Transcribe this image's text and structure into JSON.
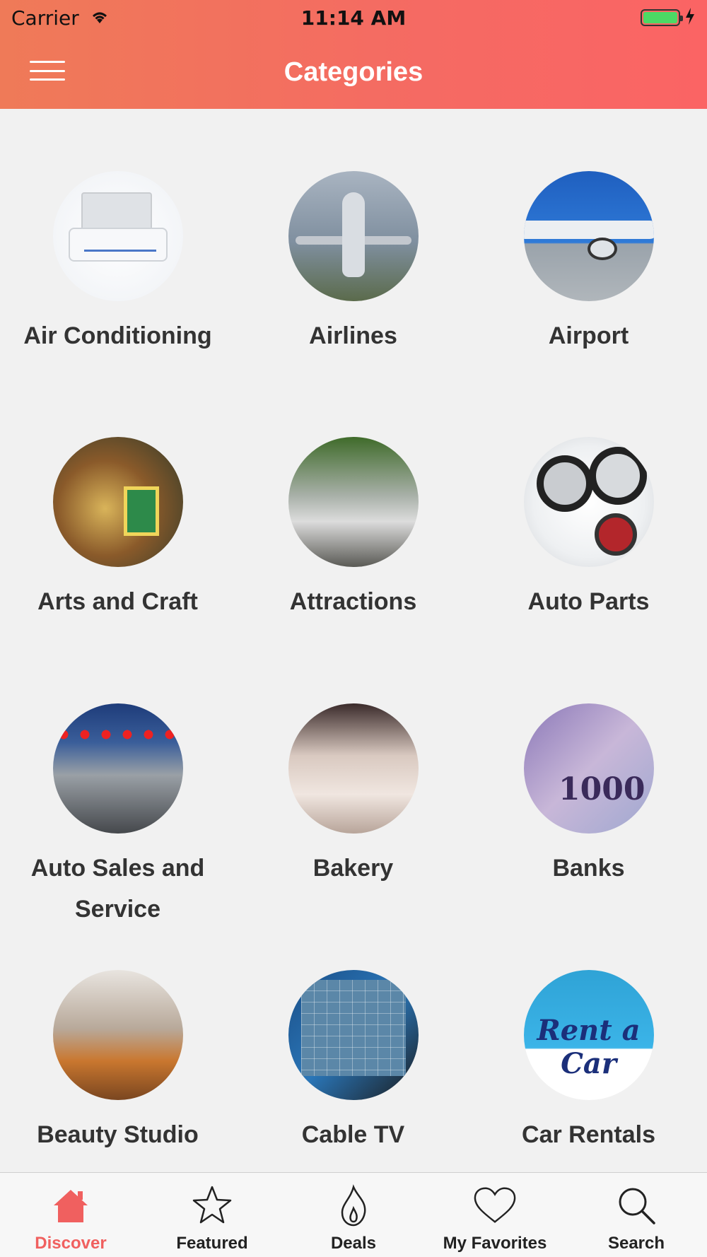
{
  "status_bar": {
    "carrier": "Carrier",
    "time": "11:14 AM"
  },
  "nav": {
    "title": "Categories",
    "menu_icon": "hamburger-menu-icon"
  },
  "colors": {
    "header_gradient_start": "#ef7a58",
    "header_gradient_end": "#fb6464",
    "active_tab": "#f0605f",
    "label_text": "#333333"
  },
  "categories": [
    {
      "label": "Air Conditioning",
      "icon": "air-conditioning-image"
    },
    {
      "label": "Airlines",
      "icon": "airlines-image"
    },
    {
      "label": "Airport",
      "icon": "airport-image"
    },
    {
      "label": "Arts and Craft",
      "icon": "arts-and-craft-image"
    },
    {
      "label": "Attractions",
      "icon": "attractions-image"
    },
    {
      "label": "Auto Parts",
      "icon": "auto-parts-image"
    },
    {
      "label": "Auto Sales and Service",
      "icon": "auto-sales-image"
    },
    {
      "label": "Bakery",
      "icon": "bakery-image"
    },
    {
      "label": "Banks",
      "icon": "banks-image"
    },
    {
      "label": "Beauty Studio",
      "icon": "beauty-studio-image"
    },
    {
      "label": "Cable TV",
      "icon": "cable-tv-image"
    },
    {
      "label": "Car Rentals",
      "icon": "car-rentals-image"
    }
  ],
  "tabs": [
    {
      "label": "Discover",
      "icon": "home-icon",
      "active": true
    },
    {
      "label": "Featured",
      "icon": "star-icon",
      "active": false
    },
    {
      "label": "Deals",
      "icon": "flame-icon",
      "active": false
    },
    {
      "label": "My Favorites",
      "icon": "heart-icon",
      "active": false
    },
    {
      "label": "Search",
      "icon": "search-icon",
      "active": false
    }
  ],
  "thumb_text": {
    "banks_note": "1000",
    "car_rental": "Rent a Car"
  }
}
